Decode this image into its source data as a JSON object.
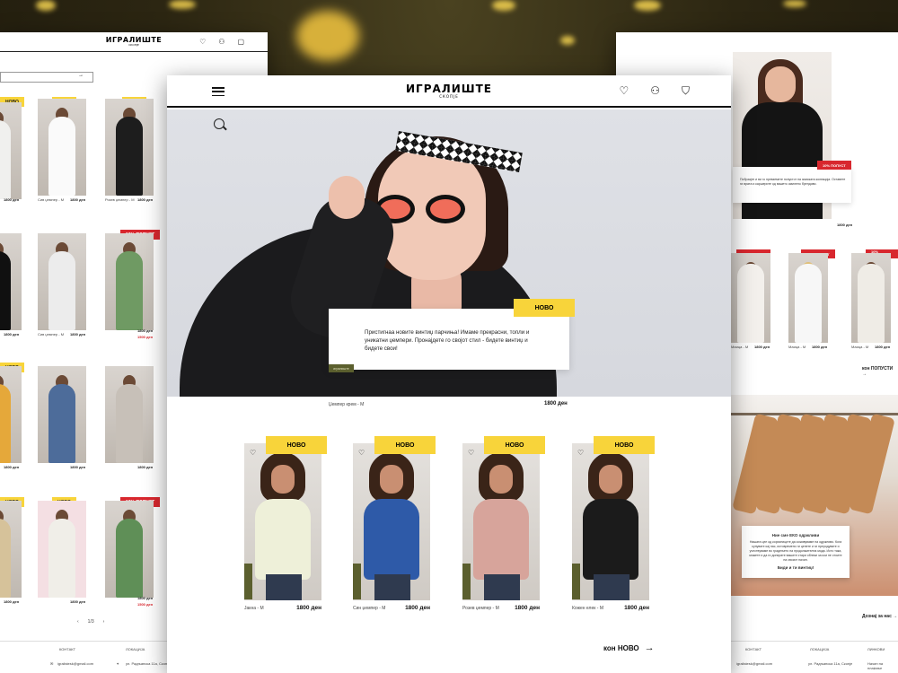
{
  "brand": {
    "logo": "ИГРАЛИШТЕ",
    "city": "СКОПЈЕ"
  },
  "colors": {
    "accent_yellow": "#f8d43a",
    "sale_red": "#d8272e",
    "olive": "#5b5f2e"
  },
  "header": {
    "icons": [
      "menu-icon",
      "heart-icon",
      "user-icon",
      "bag-icon"
    ]
  },
  "hero": {
    "badge": "НОВО",
    "text": "Пристигнаа новите винтиџ парчиња! Имаме прекрасни, топли и уникатни џемпери. Пронајдете го својот стил - бидете винтиџ и бидете свои!",
    "brand_tag": "игралиште",
    "caption": "Џемпер крем - М",
    "price": "1800 ден"
  },
  "products": [
    {
      "badge": "НОВО",
      "caption": "Јакна - М",
      "price": "1800 ден",
      "color": "#ecefd6"
    },
    {
      "badge": "НОВО",
      "caption": "Син џемпер - М",
      "price": "1800 ден",
      "color": "#2e5aa8"
    },
    {
      "badge": "НОВО",
      "caption": "Розев џемпер - М",
      "price": "1800 ден",
      "color": "#d7a49b"
    },
    {
      "badge": "НОВО",
      "caption": "Кожен елек - М",
      "price": "1800 ден",
      "color": "#1b1b1b"
    }
  ],
  "see_more": "кон НОВО",
  "left_page": {
    "tags": [
      "НОВО",
      "НОВО",
      "10% ПОПУСТ"
    ],
    "captions": [
      "Сив џемпер - М",
      "Розев џемпер - М",
      "Сив џемпер - М",
      "Сив џемпер - М"
    ],
    "price": "1800 ден",
    "sale_price": "1500 ден",
    "pagination": "1/3",
    "footer": {
      "contact": "КОНТАКТ",
      "location": "ЛОКАЦИЈА",
      "email": "igralistesk@gmail.com",
      "address": "ул. Радњанска 11а, Скопје"
    }
  },
  "right_page": {
    "promo_badge": "10% ПОПУСТ",
    "promo_text": "Побрзајте и ви го превземете попустот на зимската колекција. Оставете ги врата и каршерите од вашето омилено брендови.",
    "price": "1800 ден",
    "sale_items": [
      {
        "badge": "10% ПОПУСТ",
        "caption": "Маица - М",
        "price": "1800 ден"
      },
      {
        "badge": "10% ПОПУСТ",
        "caption": "Маица - М",
        "price": "1800 ден"
      },
      {
        "badge": "10% ПОПУСТ",
        "caption": "Маица - М",
        "price": "1800 ден"
      }
    ],
    "sale_link": "кон ПОПУСТИ",
    "eco_title": "Ние сме ЕКО одржливи",
    "eco_text": "Нашата цел од корисниците да соживуваме на одржливо. Кога купувате кај нас, истовремено ги ценете и ги преродувате и учествуваме во градењето на продолжителна мода. Исто така, можете и да ги донирате вашите стари облеки за кои не стоите на своиот начин.",
    "eco_cta": "Биди и ти винтиџ!",
    "about_link": "Дознај за нас",
    "footer": {
      "contact": "КОНТАКТ",
      "location": "ЛОКАЦИЈА",
      "links": "ЛИНКОВИ",
      "email": "igralistesk@gmail.com",
      "address": "ул. Радњанска 11а, Скопје",
      "terms": "Начин на плаќање"
    }
  }
}
